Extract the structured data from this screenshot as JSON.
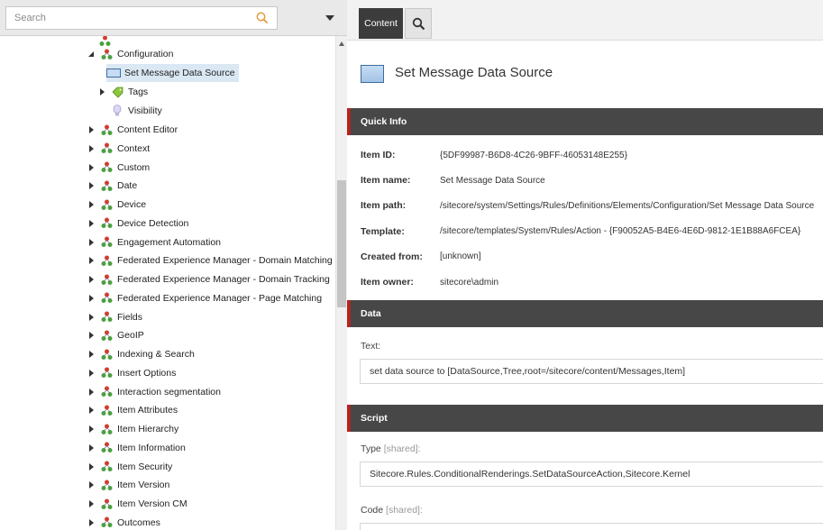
{
  "search": {
    "placeholder": "Search"
  },
  "tree": {
    "items": [
      {
        "label": "Configuration"
      },
      {
        "label": "Set Message Data Source"
      },
      {
        "label": "Tags"
      },
      {
        "label": "Visibility"
      },
      {
        "label": "Content Editor"
      },
      {
        "label": "Context"
      },
      {
        "label": "Custom"
      },
      {
        "label": "Date"
      },
      {
        "label": "Device"
      },
      {
        "label": "Device Detection"
      },
      {
        "label": "Engagement Automation"
      },
      {
        "label": "Federated Experience Manager - Domain Matching"
      },
      {
        "label": "Federated Experience Manager - Domain Tracking"
      },
      {
        "label": "Federated Experience Manager - Page Matching"
      },
      {
        "label": "Fields"
      },
      {
        "label": "GeoIP"
      },
      {
        "label": "Indexing & Search"
      },
      {
        "label": "Insert Options"
      },
      {
        "label": "Interaction segmentation"
      },
      {
        "label": "Item Attributes"
      },
      {
        "label": "Item Hierarchy"
      },
      {
        "label": "Item Information"
      },
      {
        "label": "Item Security"
      },
      {
        "label": "Item Version"
      },
      {
        "label": "Item Version CM"
      },
      {
        "label": "Outcomes"
      }
    ]
  },
  "ribbon": {
    "tab_content": "Content"
  },
  "item": {
    "title": "Set Message Data Source"
  },
  "quick_info": {
    "header": "Quick Info",
    "rows": [
      {
        "label": "Item ID:",
        "value": "{5DF99987-B6D8-4C26-9BFF-46053148E255}"
      },
      {
        "label": "Item name:",
        "value": "Set Message Data Source"
      },
      {
        "label": "Item path:",
        "value": "/sitecore/system/Settings/Rules/Definitions/Elements/Configuration/Set Message Data Source"
      },
      {
        "label": "Template:",
        "value": "/sitecore/templates/System/Rules/Action - {F90052A5-B4E6-4E6D-9812-1E1B88A6FCEA}"
      },
      {
        "label": "Created from:",
        "value": "[unknown]"
      },
      {
        "label": "Item owner:",
        "value": "sitecore\\admin"
      }
    ]
  },
  "data_section": {
    "header": "Data",
    "text_label": "Text:",
    "text_value": "set data source to [DataSource,Tree,root=/sitecore/content/Messages,Item]"
  },
  "script_section": {
    "header": "Script",
    "type_label": "Type",
    "type_shared": "[shared]:",
    "type_value": "Sitecore.Rules.ConditionalRenderings.SetDataSourceAction,Sitecore.Kernel",
    "code_label": "Code",
    "code_shared": "[shared]:"
  },
  "colors": {
    "section_header_bg": "#474747",
    "section_accent": "#b32420",
    "selected_row_bg": "#dae8f4",
    "active_tab_bg": "#3c3c3c"
  }
}
